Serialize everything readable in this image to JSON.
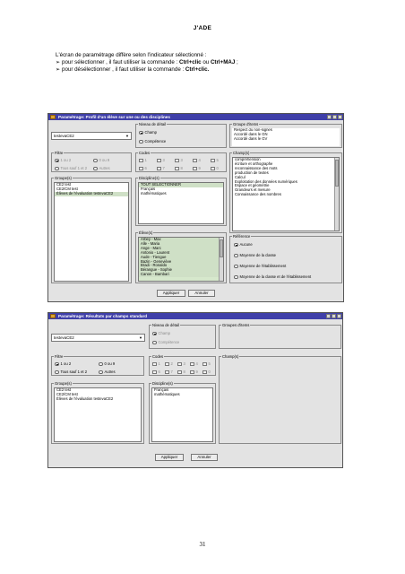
{
  "header": {
    "title": "J'ADE"
  },
  "intro": {
    "line1": "L'écran de paramétrage diffère selon l'indicateur sélectionné :",
    "line2_prefix": "pour sélectionner , il faut utiliser la commande : ",
    "line2_cmd1": "Ctrl+clic",
    "line2_mid": " ou ",
    "line2_cmd2": "Ctrl+MAJ",
    "line2_suffix": " ;",
    "line3_prefix": "pour désélectionner , il faut utiliser la commande : ",
    "line3_cmd": "Ctrl+clic."
  },
  "page_number": "31",
  "window1": {
    "title": "Paramétrage: Profil d'un élève sur une ou des disciplines",
    "combo_value": "testevaCE2",
    "niveau": {
      "label": "Niveau de détail",
      "options": [
        "Champ",
        "Compétence"
      ]
    },
    "groupe_items": {
      "label": "Groupe d'items",
      "items": [
        "Respect du non-signes",
        "Accordé dans le GN",
        "Accordé dans le GV"
      ]
    },
    "filtre": {
      "label": "Filtre",
      "options": [
        "1 ou 2",
        "0 ou 9",
        "Tous sauf 1 et 2",
        "Autres"
      ]
    },
    "codes": {
      "label": "Codes",
      "values": [
        "1",
        "3",
        "3",
        "4",
        "5",
        "6",
        "7",
        "8",
        "9",
        "0"
      ]
    },
    "groupes": {
      "label": "Groupe(s)",
      "items": [
        "CE2 test",
        "CE2/CM test",
        "Élèves de l'évaluation testevaCE2"
      ]
    },
    "disciplines": {
      "label": "Discipline(s)",
      "items": [
        "TOUT SÉLECTIONNER",
        "Français",
        "mathématiques"
      ]
    },
    "champs": {
      "label": "Champ(s)",
      "items": [
        "compréhension",
        "écriture et orthographe",
        "reconnaissance des mots",
        "production de textes",
        "Calcul",
        "Exploitation des données numériques",
        "Espace et géométrie",
        "Grandeurs et mesure",
        "Connaissance des nombres"
      ]
    },
    "eleves": {
      "label": "Élève(s)",
      "items": [
        "Arbey - Max",
        "Alle - Maria",
        "Ange - Marc",
        "Antonio - Laurent",
        "Aude - Tiengue",
        "Bazin - Geneviève",
        "Bradi - Ronaldo",
        "Bérangue - Sophie",
        "Canon - Bambari"
      ]
    },
    "reference": {
      "label": "Référence",
      "options": [
        "Aucune",
        "Moyenne de la classe",
        "Moyenne de l'établissement",
        "Moyenne de la classe et de l'établissement"
      ]
    },
    "buttons": {
      "apply": "Appliquer",
      "cancel": "Annuler"
    }
  },
  "window2": {
    "title": "Paramétrage: Résultats par champs standard",
    "combo_value": "testevaCE2",
    "niveau": {
      "label": "Niveau de détail",
      "options": [
        "Champ",
        "Compétence"
      ]
    },
    "groupe_items": {
      "label": "Groupes d'items"
    },
    "filtre": {
      "label": "Filtre",
      "options": [
        "1 ou 2",
        "0 ou 9",
        "Tous sauf 1 et 2",
        "Autres"
      ]
    },
    "codes": {
      "label": "Codes",
      "values": [
        "1",
        "2",
        "3",
        "4",
        "5",
        "6",
        "7",
        "8",
        "9",
        "0"
      ]
    },
    "champs": {
      "label": "Champ(s)"
    },
    "groupes": {
      "label": "Groupe(s)",
      "items": [
        "CE2 test",
        "CE2/CM test",
        "Élèves de l'évaluation testevaCE2"
      ]
    },
    "disciplines": {
      "label": "Discipline(s)",
      "items": [
        "Français",
        "mathématiques"
      ]
    },
    "buttons": {
      "apply": "Appliquer",
      "cancel": "Annuler"
    }
  },
  "colors": {
    "titlebar": "#3f3fa8",
    "window_bg": "#e3e3e3",
    "selection": "#cfe0c6"
  }
}
